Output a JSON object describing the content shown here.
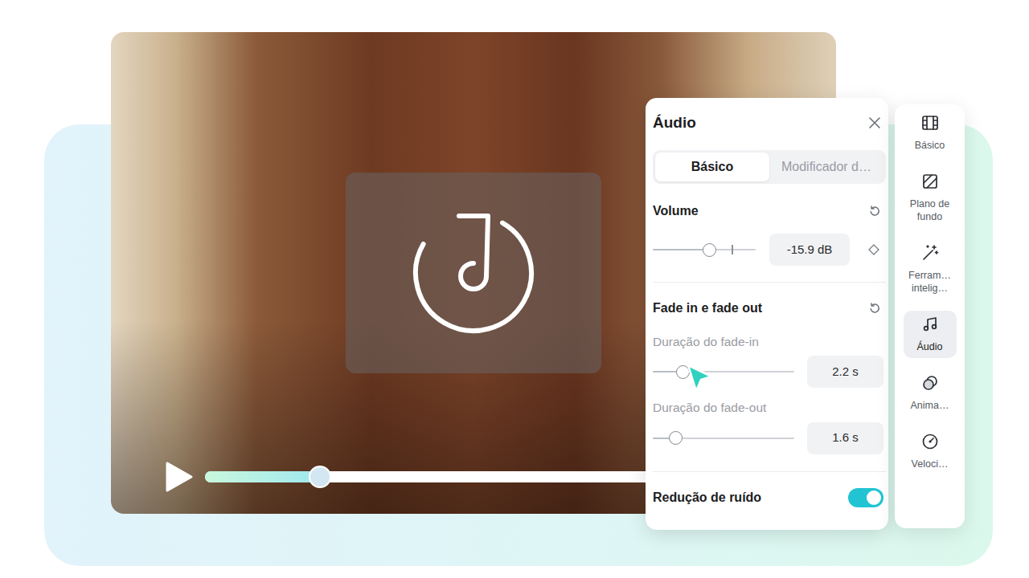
{
  "video": {
    "progress": {
      "level": 0.19
    }
  },
  "audio_panel": {
    "title": "Áudio",
    "tabs": [
      {
        "label": "Básico",
        "selected": true
      },
      {
        "label": "Modificador d…",
        "selected": false
      }
    ],
    "volume": {
      "label": "Volume",
      "level": 0.55,
      "reading": "-15.9 dB"
    },
    "fade": {
      "label": "Fade in e fade out",
      "sliders": [
        {
          "label": "Duração do fade-in",
          "level": 0.21,
          "reading": "2.2 s"
        },
        {
          "label": "Duração do fade-out",
          "level": 0.16,
          "reading": "1.6 s"
        }
      ]
    },
    "noise_reduction": {
      "label": "Redução de ruído",
      "on": true
    }
  },
  "sidebar": {
    "items": [
      {
        "label": "Básico",
        "selected": false
      },
      {
        "label": "Plano de fundo",
        "selected": false
      },
      {
        "label": "Ferram… intelig…",
        "selected": false
      },
      {
        "label": "Áudio",
        "selected": true
      },
      {
        "label": "Anima…",
        "selected": false
      },
      {
        "label": "Veloci…",
        "selected": false
      }
    ]
  }
}
